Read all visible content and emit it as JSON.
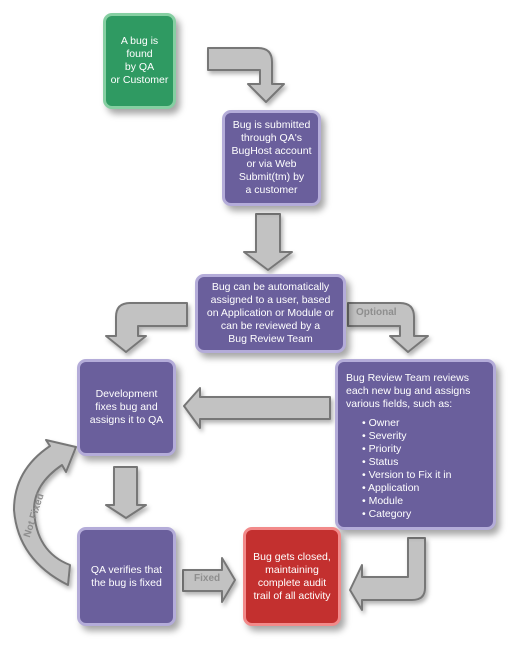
{
  "colors": {
    "start": "#2f9a62",
    "step": "#6a5f9c",
    "end": "#c3302f",
    "arrow": "#c2c2c2"
  },
  "nodes": {
    "found": [
      "A bug is found",
      "by QA",
      "or Customer"
    ],
    "submitted": [
      "Bug is submitted",
      "through QA's",
      "BugHost account",
      "or via Web",
      "Submit(tm) by",
      "a customer"
    ],
    "assigned": [
      "Bug can be automatically",
      "assigned to a user, based",
      "on Application or Module or",
      "can be reviewed by a",
      "Bug Review Team"
    ],
    "development": [
      "Development",
      "fixes bug and",
      "assigns it to QA"
    ],
    "review": {
      "intro": [
        "Bug Review Team reviews",
        "each new bug and assigns",
        "various fields, such as:"
      ],
      "fields": [
        "Owner",
        "Severity",
        "Priority",
        "Status",
        "Version to Fix it in",
        "Application",
        "Module",
        "Category"
      ]
    },
    "verify": [
      "QA verifies that",
      "the bug is fixed"
    ],
    "closed": [
      "Bug gets closed,",
      "maintaining",
      "complete audit",
      "trail of all activity"
    ]
  },
  "labels": {
    "optional": "Optional",
    "fixed": "Fixed",
    "not_fixed": "Not Fixed"
  }
}
